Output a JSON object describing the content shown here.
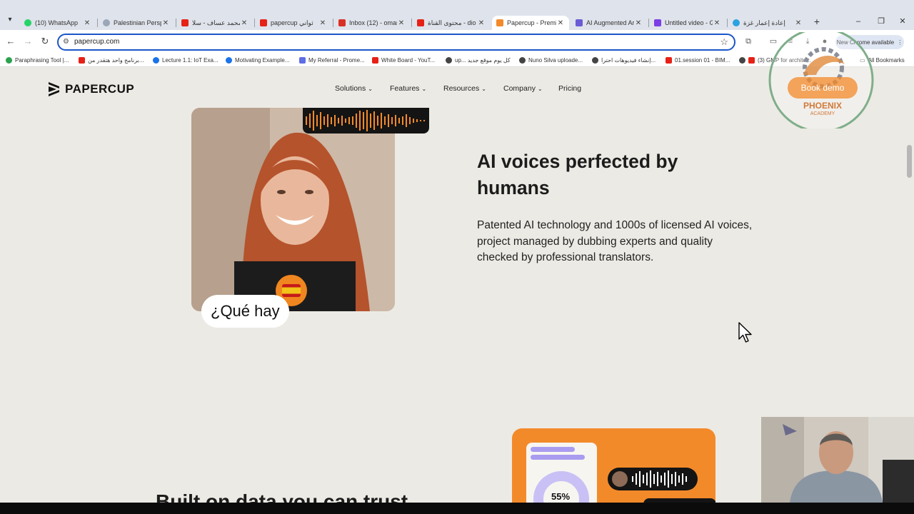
{
  "browser": {
    "tabs": [
      {
        "title": "(10) WhatsApp",
        "icon": "whatsapp-icon",
        "color": "#25d366"
      },
      {
        "title": "Palestinian Perspe",
        "icon": "globe-icon",
        "color": "#9aa7b8"
      },
      {
        "title": "محمد عساف - سلا",
        "icon": "youtube-icon",
        "color": "#e62117"
      },
      {
        "title": "papercup ثواني",
        "icon": "youtube-icon",
        "color": "#e62117"
      },
      {
        "title": "Inbox (12) - omar",
        "icon": "gmail-icon",
        "color": "#d93025"
      },
      {
        "title": "محتوى القناة - dio",
        "icon": "youtube-icon",
        "color": "#e62117"
      },
      {
        "title": "Papercup - Premi",
        "icon": "papercup-icon",
        "color": "#f38a2a"
      },
      {
        "title": "AI Augmented Ar",
        "icon": "ai-icon",
        "color": "#6b5bd6"
      },
      {
        "title": "Untitled video - G",
        "icon": "video-icon",
        "color": "#7b3fe4"
      },
      {
        "title": "إعادة إعمار غزة",
        "icon": "telegram-icon",
        "color": "#2aa3e0"
      }
    ],
    "url": "papercup.com",
    "update_label": "New Chrome available",
    "bookmarks": [
      {
        "label": "Paraphrasing Tool |...",
        "color": "#2ba24c"
      },
      {
        "label": "برنامج واحد هتقدر من...",
        "color": "#e62117"
      },
      {
        "label": "Lecture 1.1: IoT Exa...",
        "color": "#1a73e8"
      },
      {
        "label": "Motivating Example...",
        "color": "#1a73e8"
      },
      {
        "label": "My Referral - Prome...",
        "color": "#5f6de6"
      },
      {
        "label": "White Board - YouT...",
        "color": "#e62117"
      },
      {
        "label": "up... كل يوم موقع جديد",
        "color": "#444444"
      },
      {
        "label": "Nuno Silva uploade...",
        "color": "#444444"
      },
      {
        "label": "إنشاء فيديوهات احترا...",
        "color": "#444444"
      },
      {
        "label": "01.session 01 - BIM...",
        "color": "#e62117"
      },
      {
        "label": "(3) GMP for archite...",
        "color": "#e62117"
      }
    ],
    "all_bookmarks_label": "All Bookmarks"
  },
  "site": {
    "logo_text": "PAPERCUP",
    "nav": [
      {
        "label": "Solutions",
        "has_dropdown": true
      },
      {
        "label": "Features",
        "has_dropdown": true
      },
      {
        "label": "Resources",
        "has_dropdown": true
      },
      {
        "label": "Company",
        "has_dropdown": true
      },
      {
        "label": "Pricing",
        "has_dropdown": false
      }
    ],
    "book_demo_label": "Book demo"
  },
  "hero": {
    "subtitle_text": "¿Qué hay",
    "headline": "AI voices perfected by humans",
    "body": "Patented AI technology and 1000s of licensed AI voices, project managed by dubbing experts and quality checked by professional translators."
  },
  "data_card": {
    "percent": "55%"
  },
  "next_section": {
    "heading": "Built on data you can trust"
  },
  "watermark": {
    "title": "PHOENIX",
    "subtitle": "ACADEMY"
  },
  "colors": {
    "brand_orange": "#f38a2a",
    "page_bg": "#eceae4",
    "lavender": "#a99cf0",
    "omnibox_focus": "#1a56c8"
  }
}
